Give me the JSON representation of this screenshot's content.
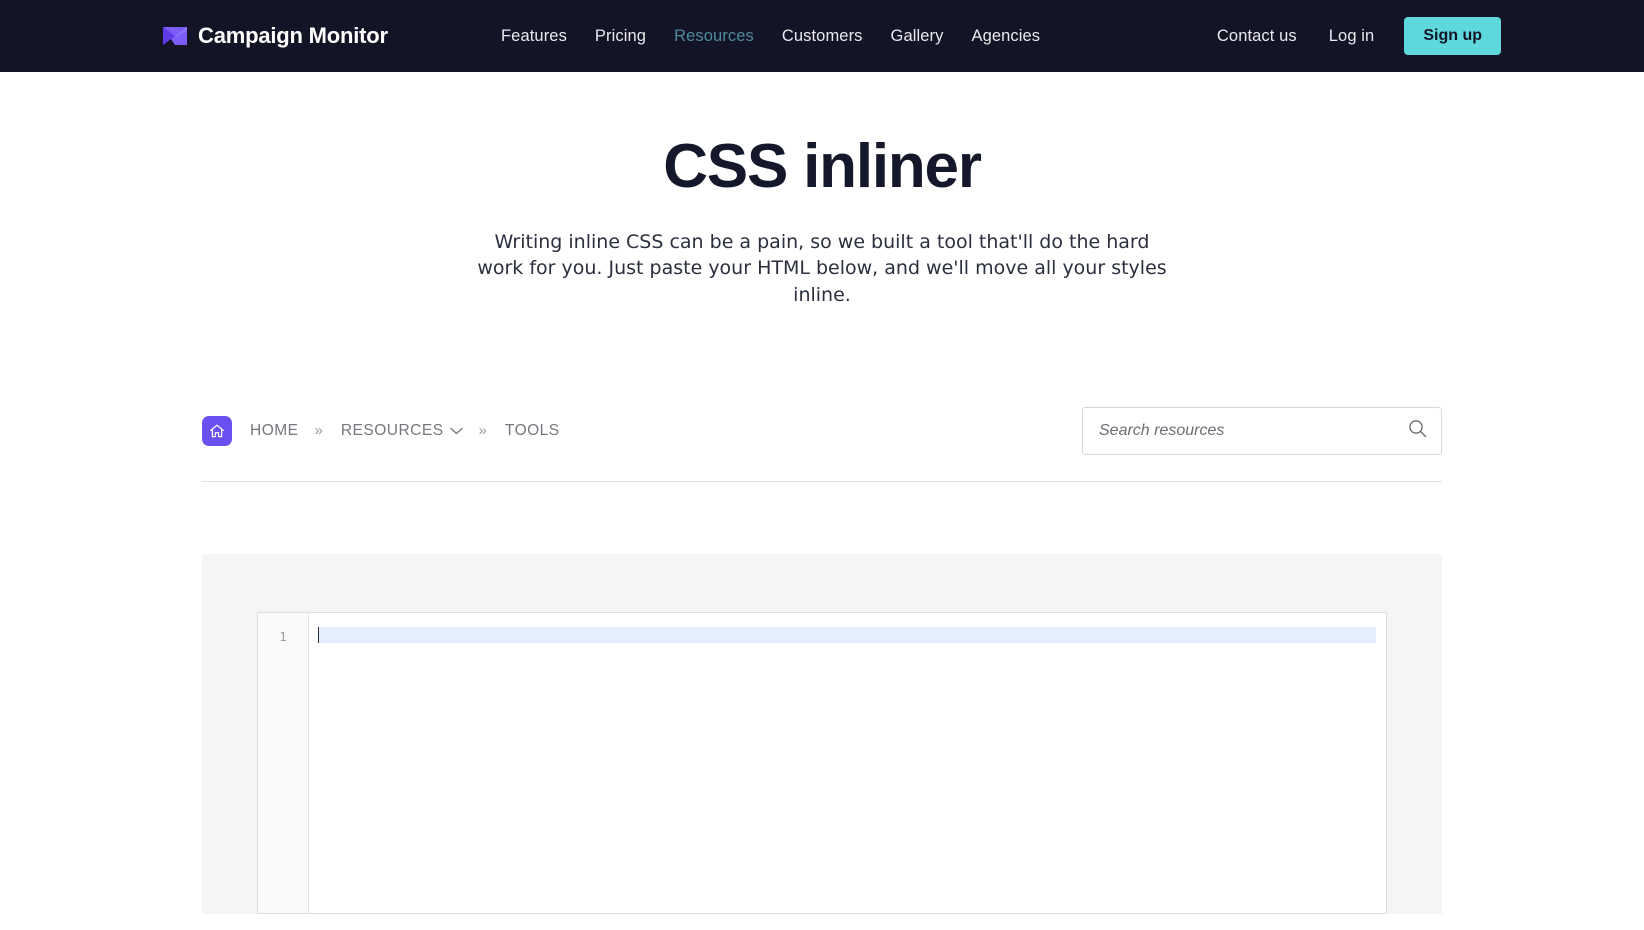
{
  "nav": {
    "brand": {
      "name": "Campaign Monitor",
      "logo_icon": "envelope-logo-icon",
      "logo_color": "#6c4ff0"
    },
    "center_links": [
      {
        "label": "Features",
        "active": false
      },
      {
        "label": "Pricing",
        "active": false
      },
      {
        "label": "Resources",
        "active": true
      },
      {
        "label": "Customers",
        "active": false
      },
      {
        "label": "Gallery",
        "active": false
      },
      {
        "label": "Agencies",
        "active": false
      }
    ],
    "right_links": [
      {
        "label": "Contact us"
      },
      {
        "label": "Log in"
      }
    ],
    "signup_label": "Sign up",
    "colors": {
      "bar_background": "#141427",
      "active_link": "#4f8a9c",
      "signup_background": "#5ed8dd",
      "signup_text": "#141427"
    }
  },
  "hero": {
    "title": "CSS inliner",
    "subtitle": "Writing inline CSS can be a pain, so we built a tool that'll do the hard work for you. Just paste your HTML below, and we'll move all your styles inline."
  },
  "breadcrumb": {
    "home_icon": "home-icon",
    "home_chip_color": "#6c4ff0",
    "items": [
      {
        "label": "HOME",
        "has_chevron": false
      },
      {
        "label": "RESOURCES",
        "has_chevron": true
      },
      {
        "label": "TOOLS",
        "has_chevron": false
      }
    ],
    "separator": "»"
  },
  "search": {
    "value": "",
    "placeholder": "Search resources",
    "icon": "search-icon"
  },
  "editor": {
    "line_numbers": [
      "1"
    ],
    "content": "",
    "active_line_color": "#e4eefc",
    "panel_background": "#f5f5f7"
  }
}
